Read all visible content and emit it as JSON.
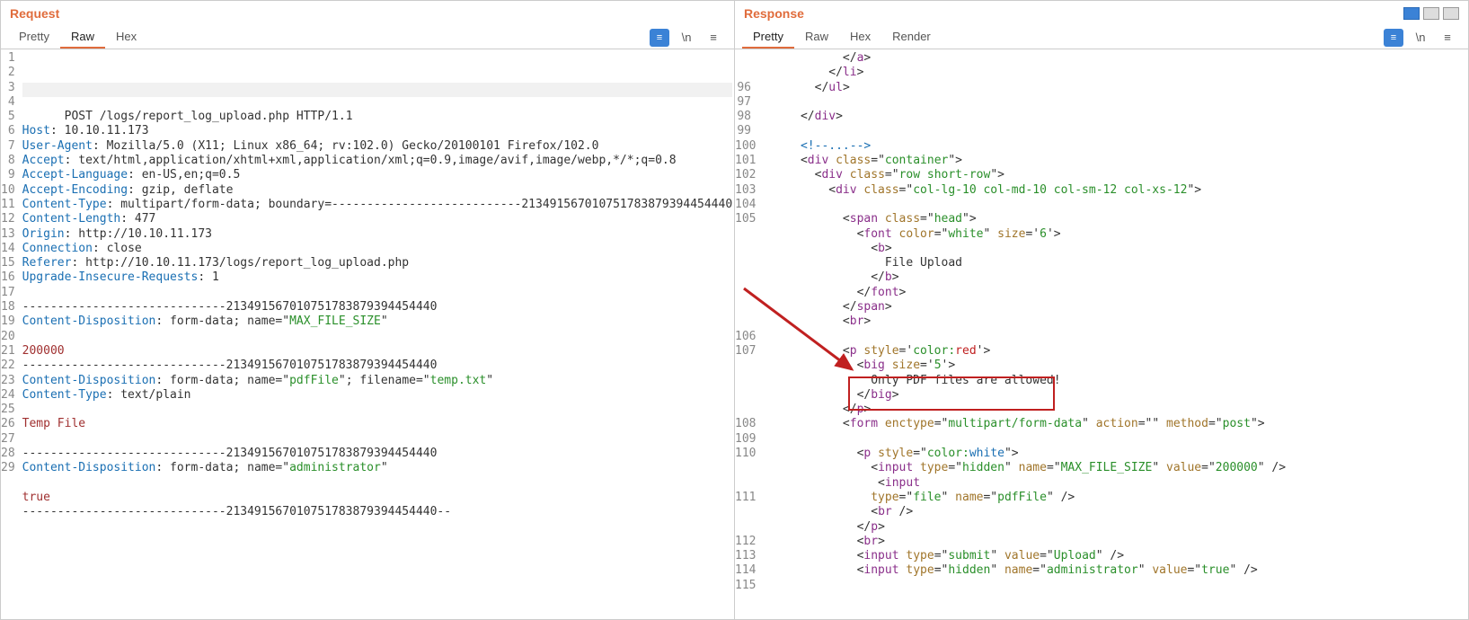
{
  "request": {
    "title": "Request",
    "tabs": [
      "Pretty",
      "Raw",
      "Hex"
    ],
    "active_tab": "Raw",
    "lines": [
      {
        "n": 1,
        "html": "POST /logs/report_log_upload.php HTTP/1.1"
      },
      {
        "n": 2,
        "html": "<span class='hdr'>Host</span>: 10.10.11.173"
      },
      {
        "n": 3,
        "html": "<span class='hdr'>User-Agent</span>: Mozilla/5.0 (X11; Linux x86_64; rv:102.0) Gecko/20100101 Firefox/102.0"
      },
      {
        "n": 4,
        "html": "<span class='hdr'>Accept</span>: text/html,application/xhtml+xml,application/xml;q=0.9,image/avif,image/webp,*/*;q=0.8"
      },
      {
        "n": 5,
        "html": "<span class='hdr'>Accept-Language</span>: en-US,en;q=0.5"
      },
      {
        "n": 6,
        "html": "<span class='hdr'>Accept-Encoding</span>: gzip, deflate"
      },
      {
        "n": 7,
        "html": "<span class='hdr'>Content-Type</span>: multipart/form-data; boundary=---------------------------213491567010751783879394454440"
      },
      {
        "n": 8,
        "html": "<span class='hdr'>Content-Length</span>: 477"
      },
      {
        "n": 9,
        "html": "<span class='hdr'>Origin</span>: http://10.10.11.173"
      },
      {
        "n": 10,
        "html": "<span class='hdr'>Connection</span>: close"
      },
      {
        "n": 11,
        "html": "<span class='hdr'>Referer</span>: http://10.10.11.173/logs/report_log_upload.php"
      },
      {
        "n": 12,
        "html": "<span class='hdr'>Upgrade-Insecure-Requests</span>: 1"
      },
      {
        "n": 13,
        "html": ""
      },
      {
        "n": 14,
        "html": "-----------------------------213491567010751783879394454440"
      },
      {
        "n": 15,
        "html": "<span class='hdr'>Content-Disposition</span>: form-data; name=\"<span class='str'>MAX_FILE_SIZE</span>\""
      },
      {
        "n": 16,
        "html": ""
      },
      {
        "n": 17,
        "html": "<span class='val'>200000</span>"
      },
      {
        "n": 18,
        "html": "-----------------------------213491567010751783879394454440"
      },
      {
        "n": 19,
        "html": "<span class='hdr'>Content-Disposition</span>: form-data; name=\"<span class='str'>pdfFile</span>\"; filename=\"<span class='str'>temp.txt</span>\""
      },
      {
        "n": 20,
        "html": "<span class='hdr'>Content-Type</span>: text/plain"
      },
      {
        "n": 21,
        "html": ""
      },
      {
        "n": 22,
        "html": "<span class='val'>Temp File</span>"
      },
      {
        "n": 23,
        "html": ""
      },
      {
        "n": 24,
        "html": "-----------------------------213491567010751783879394454440"
      },
      {
        "n": 25,
        "html": "<span class='hdr'>Content-Disposition</span>: form-data; name=\"<span class='str'>administrator</span>\""
      },
      {
        "n": 26,
        "html": ""
      },
      {
        "n": 27,
        "html": "<span class='val'>true</span>"
      },
      {
        "n": 28,
        "html": "-----------------------------213491567010751783879394454440--"
      },
      {
        "n": 29,
        "html": ""
      }
    ]
  },
  "response": {
    "title": "Response",
    "tabs": [
      "Pretty",
      "Raw",
      "Hex",
      "Render"
    ],
    "active_tab": "Pretty",
    "lines": [
      {
        "n": "",
        "html": "            &lt;/<span class='tag'>a</span>&gt;"
      },
      {
        "n": "",
        "html": "          &lt;/<span class='tag'>li</span>&gt;"
      },
      {
        "n": 96,
        "html": "        &lt;/<span class='tag'>ul</span>&gt;"
      },
      {
        "n": 97,
        "html": ""
      },
      {
        "n": 98,
        "html": "      &lt;/<span class='tag'>div</span>&gt;"
      },
      {
        "n": 99,
        "html": ""
      },
      {
        "n": 100,
        "html": "      <span class='hdr'>&lt;!--...--&gt;</span>"
      },
      {
        "n": 101,
        "html": "      &lt;<span class='tag'>div</span> <span class='attr'>class</span>=\"<span class='str'>container</span>\"&gt;"
      },
      {
        "n": 102,
        "html": "        &lt;<span class='tag'>div</span> <span class='attr'>class</span>=\"<span class='str'>row short-row</span>\"&gt;"
      },
      {
        "n": 103,
        "html": "          &lt;<span class='tag'>div</span> <span class='attr'>class</span>=\"<span class='str'>col-lg-10 col-md-10 col-sm-12 col-xs-12</span>\"&gt;"
      },
      {
        "n": 104,
        "html": ""
      },
      {
        "n": 105,
        "html": "            &lt;<span class='tag'>span</span> <span class='attr'>class</span>=\"<span class='str'>head</span>\"&gt;"
      },
      {
        "n": "",
        "html": "              &lt;<span class='tag'>font</span> <span class='attr'>color</span>=\"<span class='str'>white</span>\" <span class='attr'>size</span>='<span class='str'>6</span>'&gt;"
      },
      {
        "n": "",
        "html": "                &lt;<span class='tag'>b</span>&gt;"
      },
      {
        "n": "",
        "html": "                  File Upload"
      },
      {
        "n": "",
        "html": "                &lt;/<span class='tag'>b</span>&gt;"
      },
      {
        "n": "",
        "html": "              &lt;/<span class='tag'>font</span>&gt;"
      },
      {
        "n": "",
        "html": "            &lt;/<span class='tag'>span</span>&gt;"
      },
      {
        "n": "",
        "html": "            &lt;<span class='tag'>br</span>&gt;"
      },
      {
        "n": 106,
        "html": ""
      },
      {
        "n": 107,
        "html": "            &lt;<span class='tag'>p</span> <span class='attr'>style</span>='<span class='str'>color:<span class='red'>red</span></span>'&gt;"
      },
      {
        "n": "",
        "html": "              &lt;<span class='tag'>big</span> <span class='attr'>size</span>='<span class='str'>5</span>'&gt;"
      },
      {
        "n": "",
        "html": "                Only PDF files are allowed!"
      },
      {
        "n": "",
        "html": "              &lt;/<span class='tag'>big</span>&gt;"
      },
      {
        "n": "",
        "html": "            &lt;/<span class='tag'>p</span>&gt;"
      },
      {
        "n": 108,
        "html": "            &lt;<span class='tag'>form</span> <span class='attr'>enctype</span>=\"<span class='str'>multipart/form-data</span>\" <span class='attr'>action</span>=\"\" <span class='attr'>method</span>=\"<span class='str'>post</span>\"&gt;"
      },
      {
        "n": 109,
        "html": ""
      },
      {
        "n": 110,
        "html": "              &lt;<span class='tag'>p</span> <span class='attr'>style</span>=\"<span class='str'>color:<span class='num'>white</span></span>\"&gt;"
      },
      {
        "n": "",
        "html": "                &lt;<span class='tag'>input</span> <span class='attr'>type</span>=\"<span class='str'>hidden</span>\" <span class='attr'>name</span>=\"<span class='str'>MAX_FILE_SIZE</span>\" <span class='attr'>value</span>=\"<span class='str'>200000</span>\" /&gt;"
      },
      {
        "n": "",
        "html": "                 &lt;<span class='tag'>input</span>"
      },
      {
        "n": 111,
        "html": "                <span class='attr'>type</span>=\"<span class='str'>file</span>\" <span class='attr'>name</span>=\"<span class='str'>pdfFile</span>\" /&gt;"
      },
      {
        "n": "",
        "html": "                &lt;<span class='tag'>br</span> /&gt;"
      },
      {
        "n": "",
        "html": "              &lt;/<span class='tag'>p</span>&gt;"
      },
      {
        "n": 112,
        "html": "              &lt;<span class='tag'>br</span>&gt;"
      },
      {
        "n": 113,
        "html": "              &lt;<span class='tag'>input</span> <span class='attr'>type</span>=\"<span class='str'>submit</span>\" <span class='attr'>value</span>=\"<span class='str'>Upload</span>\" /&gt;"
      },
      {
        "n": 114,
        "html": "              &lt;<span class='tag'>input</span> <span class='attr'>type</span>=\"<span class='str'>hidden</span>\" <span class='attr'>name</span>=\"<span class='str'>administrator</span>\" <span class='attr'>value</span>=\"<span class='str'>true</span>\" /&gt;"
      },
      {
        "n": 115,
        "html": ""
      }
    ]
  },
  "tool_newline_label": "\\n",
  "annotation_message": "Only PDF files are allowed!"
}
